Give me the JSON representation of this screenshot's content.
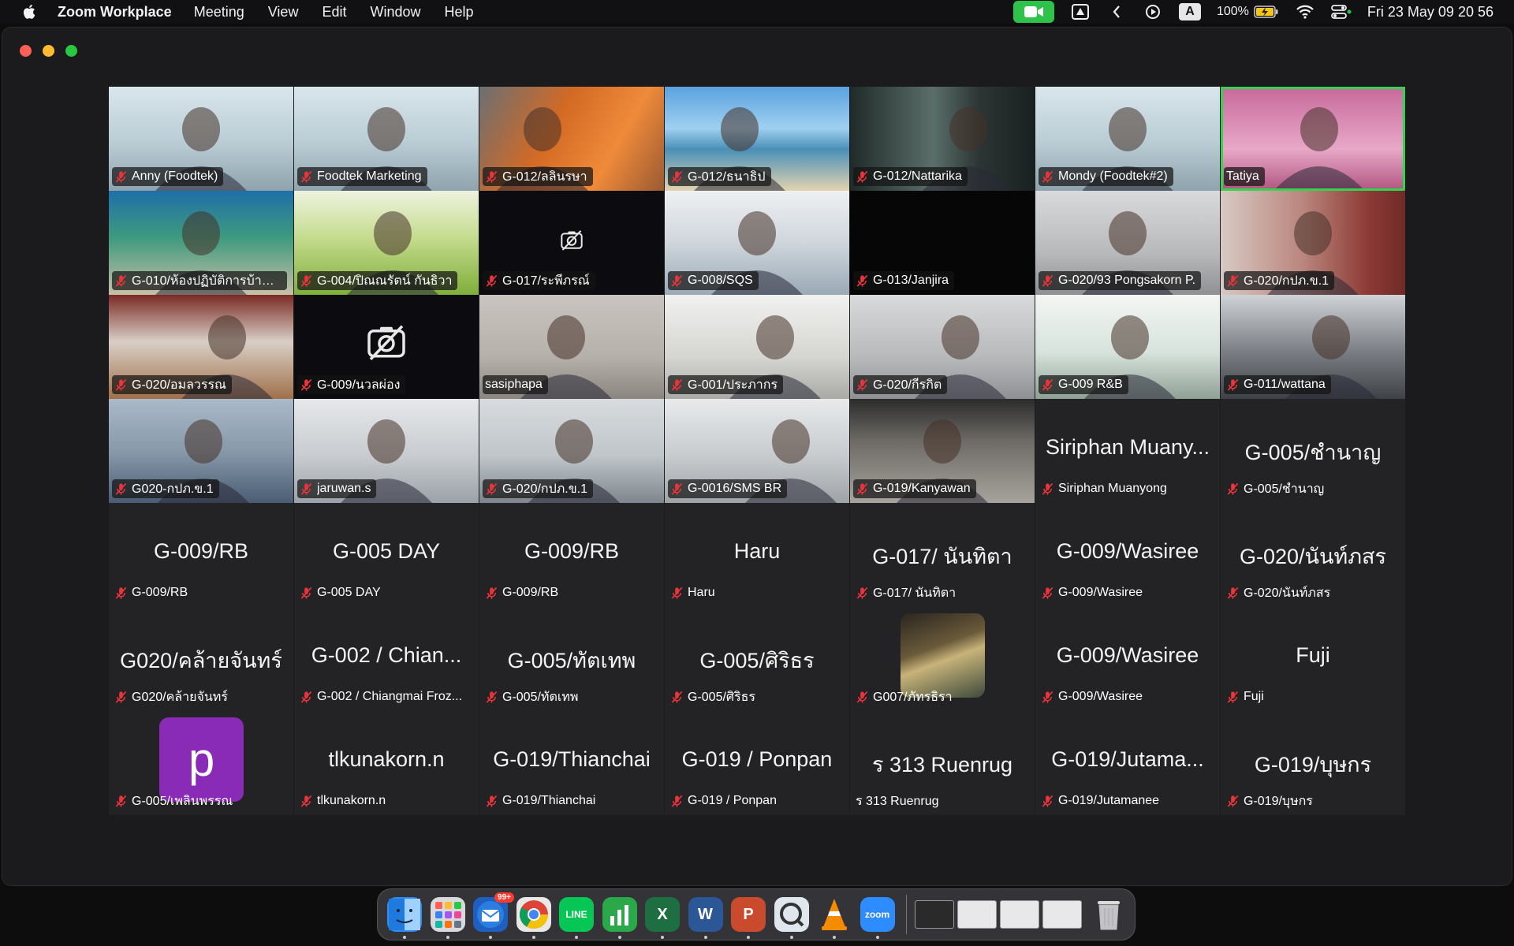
{
  "menubar": {
    "app_name": "Zoom Workplace",
    "menus": [
      "Meeting",
      "View",
      "Edit",
      "Window",
      "Help"
    ],
    "battery": "100%",
    "clock": "Fri 23 May  09 20 56",
    "letter_indicator": "A"
  },
  "gallery": {
    "tiles": [
      {
        "name": "Anny (Foodtek)",
        "big": "",
        "muted": true,
        "video": "office",
        "active": false
      },
      {
        "name": "Foodtek Marketing",
        "big": "",
        "muted": true,
        "video": "office",
        "active": false
      },
      {
        "name": "G-012/ลลินรษา",
        "big": "",
        "muted": true,
        "video": "orange",
        "active": false
      },
      {
        "name": "G-012/ธนาธิป",
        "big": "",
        "muted": true,
        "video": "beach",
        "active": false
      },
      {
        "name": "G-012/Nattarika",
        "big": "",
        "muted": true,
        "video": "dim",
        "active": false
      },
      {
        "name": "Mondy (Foodtek#2)",
        "big": "",
        "muted": true,
        "video": "office",
        "active": false
      },
      {
        "name": "Tatiya",
        "big": "",
        "muted": false,
        "video": "pink",
        "active": true
      },
      {
        "name": "G-010/ห้องปฏิบัติการบ้านโ...",
        "big": "",
        "muted": true,
        "video": "classroom",
        "active": false
      },
      {
        "name": "G-004/ปิณณรัตน์ กันธิวา",
        "big": "",
        "muted": true,
        "video": "grass",
        "active": false
      },
      {
        "name": "G-017/ระพีภรณ์",
        "big": "",
        "muted": true,
        "video": "camoff-small",
        "active": false
      },
      {
        "name": "G-008/SQS",
        "big": "",
        "muted": true,
        "video": "lab",
        "active": false
      },
      {
        "name": "G-013/Janjira",
        "big": "",
        "muted": true,
        "video": "black",
        "active": false
      },
      {
        "name": "G-020/93 Pongsakorn P.",
        "big": "",
        "muted": true,
        "video": "grey",
        "active": false
      },
      {
        "name": "G-020/กปภ.ข.1",
        "big": "",
        "muted": true,
        "video": "redwall",
        "active": false
      },
      {
        "name": "G-020/อมลวรรณ",
        "big": "",
        "muted": true,
        "video": "woodroom",
        "active": false
      },
      {
        "name": "G-009/นวลผ่อง",
        "big": "",
        "muted": true,
        "video": "camoff",
        "active": false
      },
      {
        "name": "sasiphapa",
        "big": "",
        "muted": false,
        "video": "wall",
        "active": false
      },
      {
        "name": "G-001/ประภากร",
        "big": "",
        "muted": true,
        "video": "bright",
        "active": false
      },
      {
        "name": "G-020/กีรกิต",
        "big": "",
        "muted": true,
        "video": "grey",
        "active": false
      },
      {
        "name": "G-009 R&B",
        "big": "",
        "muted": true,
        "video": "window",
        "active": false
      },
      {
        "name": "G-011/wattana",
        "big": "",
        "muted": true,
        "video": "greydark",
        "active": false
      },
      {
        "name": "G020-กปภ.ข.1",
        "big": "",
        "muted": true,
        "video": "blue",
        "active": false
      },
      {
        "name": "jaruwan.s",
        "big": "",
        "muted": true,
        "video": "factory",
        "active": false
      },
      {
        "name": "G-020/กปภ.ข.1",
        "big": "",
        "muted": true,
        "video": "office2",
        "active": false
      },
      {
        "name": "G-0016/SMS BR",
        "big": "",
        "muted": true,
        "video": "meeting",
        "active": false
      },
      {
        "name": "G-019/Kanyawan",
        "big": "",
        "muted": true,
        "video": "ceiling",
        "active": false
      },
      {
        "name": "Siriphan Muanyong",
        "big": "Siriphan Muany...",
        "muted": true,
        "video": "none",
        "active": false
      },
      {
        "name": "G-005/ชำนาญ",
        "big": "G-005/ชำนาญ",
        "muted": true,
        "video": "none",
        "active": false
      },
      {
        "name": "G-009/RB",
        "big": "G-009/RB",
        "muted": true,
        "video": "none",
        "active": false
      },
      {
        "name": "G-005 DAY",
        "big": "G-005 DAY",
        "muted": true,
        "video": "none",
        "active": false
      },
      {
        "name": "G-009/RB",
        "big": "G-009/RB",
        "muted": true,
        "video": "none",
        "active": false
      },
      {
        "name": "Haru",
        "big": "Haru",
        "muted": true,
        "video": "none",
        "active": false
      },
      {
        "name": "G-017/ นันทิตา",
        "big": "G-017/ นันทิตา",
        "muted": true,
        "video": "none",
        "active": false
      },
      {
        "name": "G-009/Wasiree",
        "big": "G-009/Wasiree",
        "muted": true,
        "video": "none",
        "active": false
      },
      {
        "name": "G-020/นันท์ภสร",
        "big": "G-020/นันท์ภสร",
        "muted": true,
        "video": "none",
        "active": false
      },
      {
        "name": "G020/คล้ายจันทร์",
        "big": "G020/คล้ายจันทร์",
        "muted": true,
        "video": "none",
        "active": false
      },
      {
        "name": "G-002 / Chiangmai Froz...",
        "big": "G-002 / Chian...",
        "muted": true,
        "video": "none",
        "active": false
      },
      {
        "name": "G-005/ทัตเทพ",
        "big": "G-005/ทัตเทพ",
        "muted": true,
        "video": "none",
        "active": false
      },
      {
        "name": "G-005/ศิริธร",
        "big": "G-005/ศิริธร",
        "muted": true,
        "video": "none",
        "active": false
      },
      {
        "name": "G007/ภัทรธิรา",
        "big": "",
        "muted": true,
        "video": "photo",
        "active": false
      },
      {
        "name": "G-009/Wasiree",
        "big": "G-009/Wasiree",
        "muted": true,
        "video": "none",
        "active": false
      },
      {
        "name": "Fuji",
        "big": "Fuji",
        "muted": true,
        "video": "none",
        "active": false
      },
      {
        "name": "G-005/เพลินพรรณ",
        "big": "",
        "muted": true,
        "video": "avatar-p",
        "active": false
      },
      {
        "name": "tlkunakorn.n",
        "big": "tlkunakorn.n",
        "muted": true,
        "video": "none",
        "active": false
      },
      {
        "name": "G-019/Thianchai",
        "big": "G-019/Thianchai",
        "muted": true,
        "video": "none",
        "active": false
      },
      {
        "name": "G-019 / Ponpan",
        "big": "G-019 / Ponpan",
        "muted": true,
        "video": "none",
        "active": false
      },
      {
        "name": "ร 313 Ruenrug",
        "big": "ร 313 Ruenrug",
        "muted": false,
        "video": "none",
        "active": false
      },
      {
        "name": "G-019/Jutamanee",
        "big": "G-019/Jutama...",
        "muted": true,
        "video": "none",
        "active": false
      },
      {
        "name": "G-019/บุษกร",
        "big": "G-019/บุษกร",
        "muted": true,
        "video": "none",
        "active": false
      }
    ],
    "avatar_letter": "p"
  },
  "dock": {
    "apps": [
      {
        "name": "finder",
        "color": "#2f8cf0",
        "label": ""
      },
      {
        "name": "launchpad",
        "color": "#d9d9dc",
        "label": ""
      },
      {
        "name": "thunderbird",
        "color": "#1f5fbf",
        "label": "",
        "badge": "99+"
      },
      {
        "name": "chrome",
        "color": "#e8e8e8",
        "label": ""
      },
      {
        "name": "line",
        "color": "#06c755",
        "label": "LINE"
      },
      {
        "name": "numbers",
        "color": "#2aa84a",
        "label": ""
      },
      {
        "name": "excel",
        "color": "#1d6f42",
        "label": "X"
      },
      {
        "name": "word",
        "color": "#2b5797",
        "label": "W"
      },
      {
        "name": "powerpoint",
        "color": "#c94a2c",
        "label": "P"
      },
      {
        "name": "quicktime",
        "color": "#dfe6ee",
        "label": ""
      },
      {
        "name": "vlc",
        "color": "transparent",
        "label": ""
      },
      {
        "name": "zoom",
        "color": "#2d8cff",
        "label": "zoom"
      }
    ],
    "windows": [
      "dark",
      "light",
      "light",
      "light"
    ],
    "trash": "trash"
  }
}
